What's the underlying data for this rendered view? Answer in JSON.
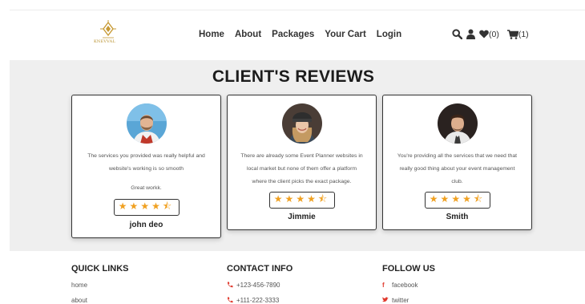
{
  "header": {
    "logo_text": "KNEVVAL",
    "nav": [
      {
        "label": "Home"
      },
      {
        "label": "About"
      },
      {
        "label": "Packages"
      },
      {
        "label": "Your Cart"
      },
      {
        "label": "Login"
      }
    ],
    "wishlist_count": "(0)",
    "cart_count": "(1)",
    "icons": [
      "search-icon",
      "user-icon",
      "heart-icon",
      "cart-icon"
    ]
  },
  "reviews": {
    "title": "CLIENT'S REVIEWS",
    "star_color": "#f0a020",
    "items": [
      {
        "text_lines": [
          "The services you provided was really helpful and",
          "website's working is so smooth",
          "",
          "Great workk."
        ],
        "rating": 4.5,
        "stars": "★★★★⯪",
        "name": "john deo"
      },
      {
        "text_lines": [
          "There are already some Event Planner websites in",
          "local market but none of them offer a platform",
          "where the client picks the exact package."
        ],
        "rating": 4.5,
        "stars": "★★★★⯪",
        "name": "Jimmie"
      },
      {
        "text_lines": [
          "You're providing all the services that we need that",
          "really good thing about your event management",
          "club."
        ],
        "rating": 4.5,
        "stars": "★★★★⯪",
        "name": "Smith"
      }
    ]
  },
  "footer": {
    "quick_links": {
      "title": "QUICK LINKS",
      "items": [
        "home",
        "about"
      ]
    },
    "contact_info": {
      "title": "CONTACT INFO",
      "items": [
        "+123-456-7890",
        "+111-222-3333"
      ]
    },
    "follow_us": {
      "title": "FOLLOW US",
      "items": [
        "facebook",
        "twitter"
      ]
    },
    "accent_color": "#e03a2e"
  }
}
